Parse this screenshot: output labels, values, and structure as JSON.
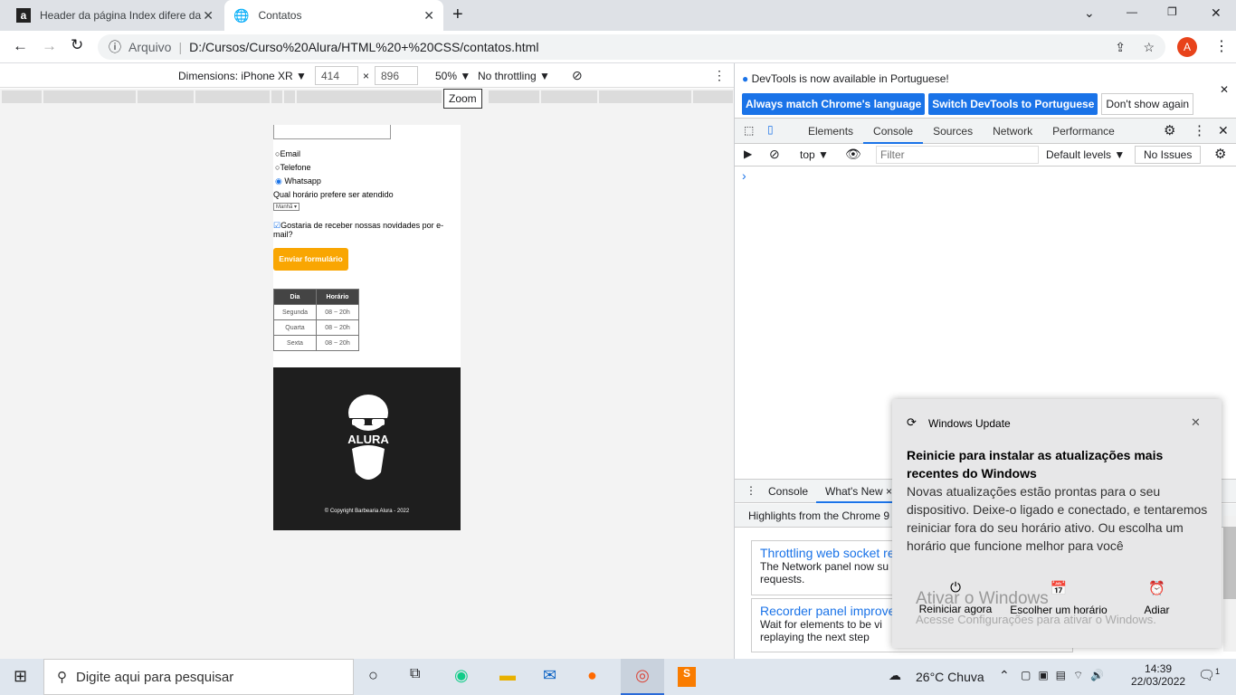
{
  "browser": {
    "tabs": [
      {
        "title": "Header da página Index difere da",
        "favicon": "a"
      },
      {
        "title": "Contatos",
        "favicon": "globe"
      }
    ],
    "url_prefix": "Arquivo",
    "url": "D:/Cursos/Curso%20Alura/HTML%20+%20CSS/contatos.html",
    "profile_initial": "A"
  },
  "device_toolbar": {
    "dimensions": "Dimensions: iPhone XR ▼",
    "width": "414",
    "height": "896",
    "zoom": "50% ▼",
    "throttling": "No throttling ▼",
    "tooltip": "Zoom"
  },
  "page": {
    "radios": [
      "Email",
      "Telefone",
      "Whatsapp"
    ],
    "selected_radio": "Whatsapp",
    "time_label": "Qual horário prefere ser atendido",
    "time_select": "Manhã",
    "newsletter": "Gostaria de receber nossas novidades por e-mail?",
    "submit": "Enviar formulário",
    "table": {
      "headers": [
        "Dia",
        "Horário"
      ],
      "rows": [
        [
          "Segunda",
          "08 ~ 20h"
        ],
        [
          "Quarta",
          "08 ~ 20h"
        ],
        [
          "Sexta",
          "08 ~ 20h"
        ]
      ]
    },
    "logo_text": "ALURA",
    "copyright": "© Copyright Barbearia Alura - 2022"
  },
  "devtools": {
    "notice": "DevTools is now available in Portuguese!",
    "btn_match": "Always match Chrome's language",
    "btn_switch": "Switch DevTools to Portuguese",
    "btn_dont": "Don't show again",
    "tabs": [
      "Elements",
      "Console",
      "Sources",
      "Network",
      "Performance"
    ],
    "active_tab": "Console",
    "context": "top ▼",
    "filter_placeholder": "Filter",
    "levels": "Default levels ▼",
    "issues": "No Issues",
    "prompt": "›",
    "drawer_tabs": [
      "Console",
      "What's New ×"
    ],
    "highlights": "Highlights from the Chrome 9",
    "cards": [
      {
        "title": "Throttling web socket re",
        "body": "The Network panel now su requests."
      },
      {
        "title": "Recorder panel improve",
        "body": "Wait for elements to be vi replaying the next step"
      }
    ]
  },
  "toast": {
    "app": "Windows Update",
    "title": "Reinicie para instalar as atualizações mais recentes do Windows",
    "body": "Novas atualizações estão prontas para o seu dispositivo. Deixe-o ligado e conectado, e tentaremos reiniciar fora do seu horário ativo. Ou escolha um horário que funcione melhor para você",
    "actions": [
      "Reiniciar agora",
      "Escolher um horário",
      "Adiar"
    ],
    "watermark1": "Ativar o Windows",
    "watermark2": "Acesse Configurações para ativar o Windows."
  },
  "taskbar": {
    "search": "Digite aqui para pesquisar",
    "weather": "26°C  Chuva",
    "time": "14:39",
    "date": "22/03/2022",
    "notifications": "1"
  }
}
